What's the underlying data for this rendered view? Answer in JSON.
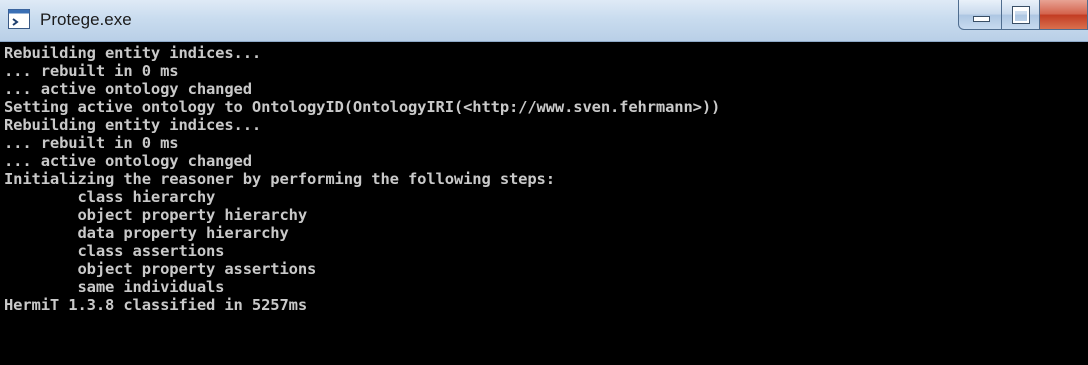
{
  "window": {
    "title": "Protege.exe",
    "app_icon": "console-app-icon",
    "controls": {
      "minimize_icon": "minimize-icon",
      "maximize_icon": "maximize-icon",
      "close_icon": "close-icon"
    },
    "colors": {
      "titlebar": "#c9dcef",
      "console_background": "#000000",
      "console_text": "#c9c9c9",
      "close_button": "#c9452b"
    }
  },
  "console": {
    "lines": [
      "Rebuilding entity indices...",
      "... rebuilt in 0 ms",
      "... active ontology changed",
      "Setting active ontology to OntologyID(OntologyIRI(<http://www.sven.fehrmann>))",
      "Rebuilding entity indices...",
      "... rebuilt in 0 ms",
      "... active ontology changed",
      "Initializing the reasoner by performing the following steps:",
      "        class hierarchy",
      "        object property hierarchy",
      "        data property hierarchy",
      "        class assertions",
      "        object property assertions",
      "        same individuals",
      "HermiT 1.3.8 classified in 5257ms"
    ]
  }
}
